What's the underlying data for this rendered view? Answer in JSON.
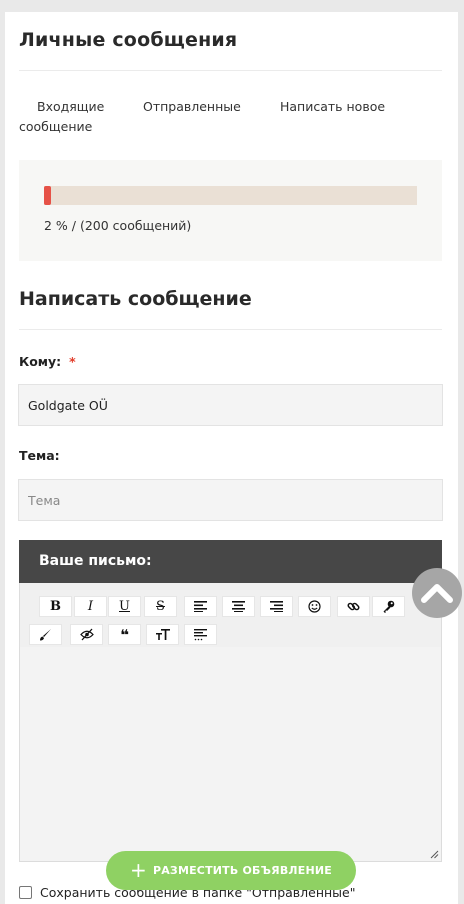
{
  "page": {
    "title": "Личные сообщения"
  },
  "tabs": {
    "inbox": "Входящие",
    "sent": "Отправленные",
    "compose_line1": "Написать новое",
    "compose_line2": "сообщение"
  },
  "quota": {
    "progress_percent": 2,
    "text": "2 % / (200 сообщений)",
    "fill_color": "#e65247",
    "track_color": "#eae0d5"
  },
  "compose": {
    "title": "Написать сообщение",
    "to_label": "Кому:",
    "required_mark": "*",
    "to_value": "Goldgate OÜ",
    "subject_label": "Тема:",
    "subject_placeholder": "Тема",
    "subject_value": "",
    "letter_label": "Ваше письмо:"
  },
  "toolbar": {
    "bold": "B",
    "italic": "I",
    "underline": "U",
    "strike": "S",
    "quote": "❝"
  },
  "actions": {
    "post_ad_label": "РАЗМЕСТИТЬ ОБЪЯВЛЕНИЕ",
    "post_ad_color": "#8fd163",
    "save_copy_label": "Сохранить сообщение в папке \"Отправленные\""
  }
}
